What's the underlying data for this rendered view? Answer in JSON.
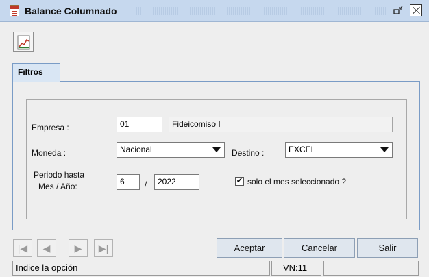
{
  "window": {
    "title": "Balance Columnado",
    "restore_glyph": "▫ᵏ"
  },
  "toolbar": {
    "report_icon": "chart-report-icon"
  },
  "tabs": [
    {
      "label": "Filtros"
    }
  ],
  "form": {
    "empresa": {
      "label": "Empresa :",
      "code": "01",
      "name": "Fideicomiso I"
    },
    "moneda": {
      "label": "Moneda :",
      "value": "Nacional"
    },
    "destino": {
      "label": "Destino :",
      "value": "EXCEL"
    },
    "periodo": {
      "label_line1": "Periodo hasta",
      "label_line2": "Mes / Año:",
      "month": "6",
      "separator": "/",
      "year": "2022"
    },
    "solo_mes": {
      "label": "solo el mes seleccionado ?",
      "checked": true,
      "mark": "✔"
    }
  },
  "navigation": {
    "first": "|◀",
    "prev": "◀",
    "next": "▶",
    "last": "▶|"
  },
  "actions": {
    "aceptar": {
      "hot": "A",
      "rest": "ceptar"
    },
    "cancelar": {
      "hot": "C",
      "rest": "ancelar"
    },
    "salir": {
      "hot": "S",
      "rest": "alir"
    }
  },
  "status": {
    "message": "Indice la opción",
    "version": "VN:11",
    "extra": ""
  }
}
